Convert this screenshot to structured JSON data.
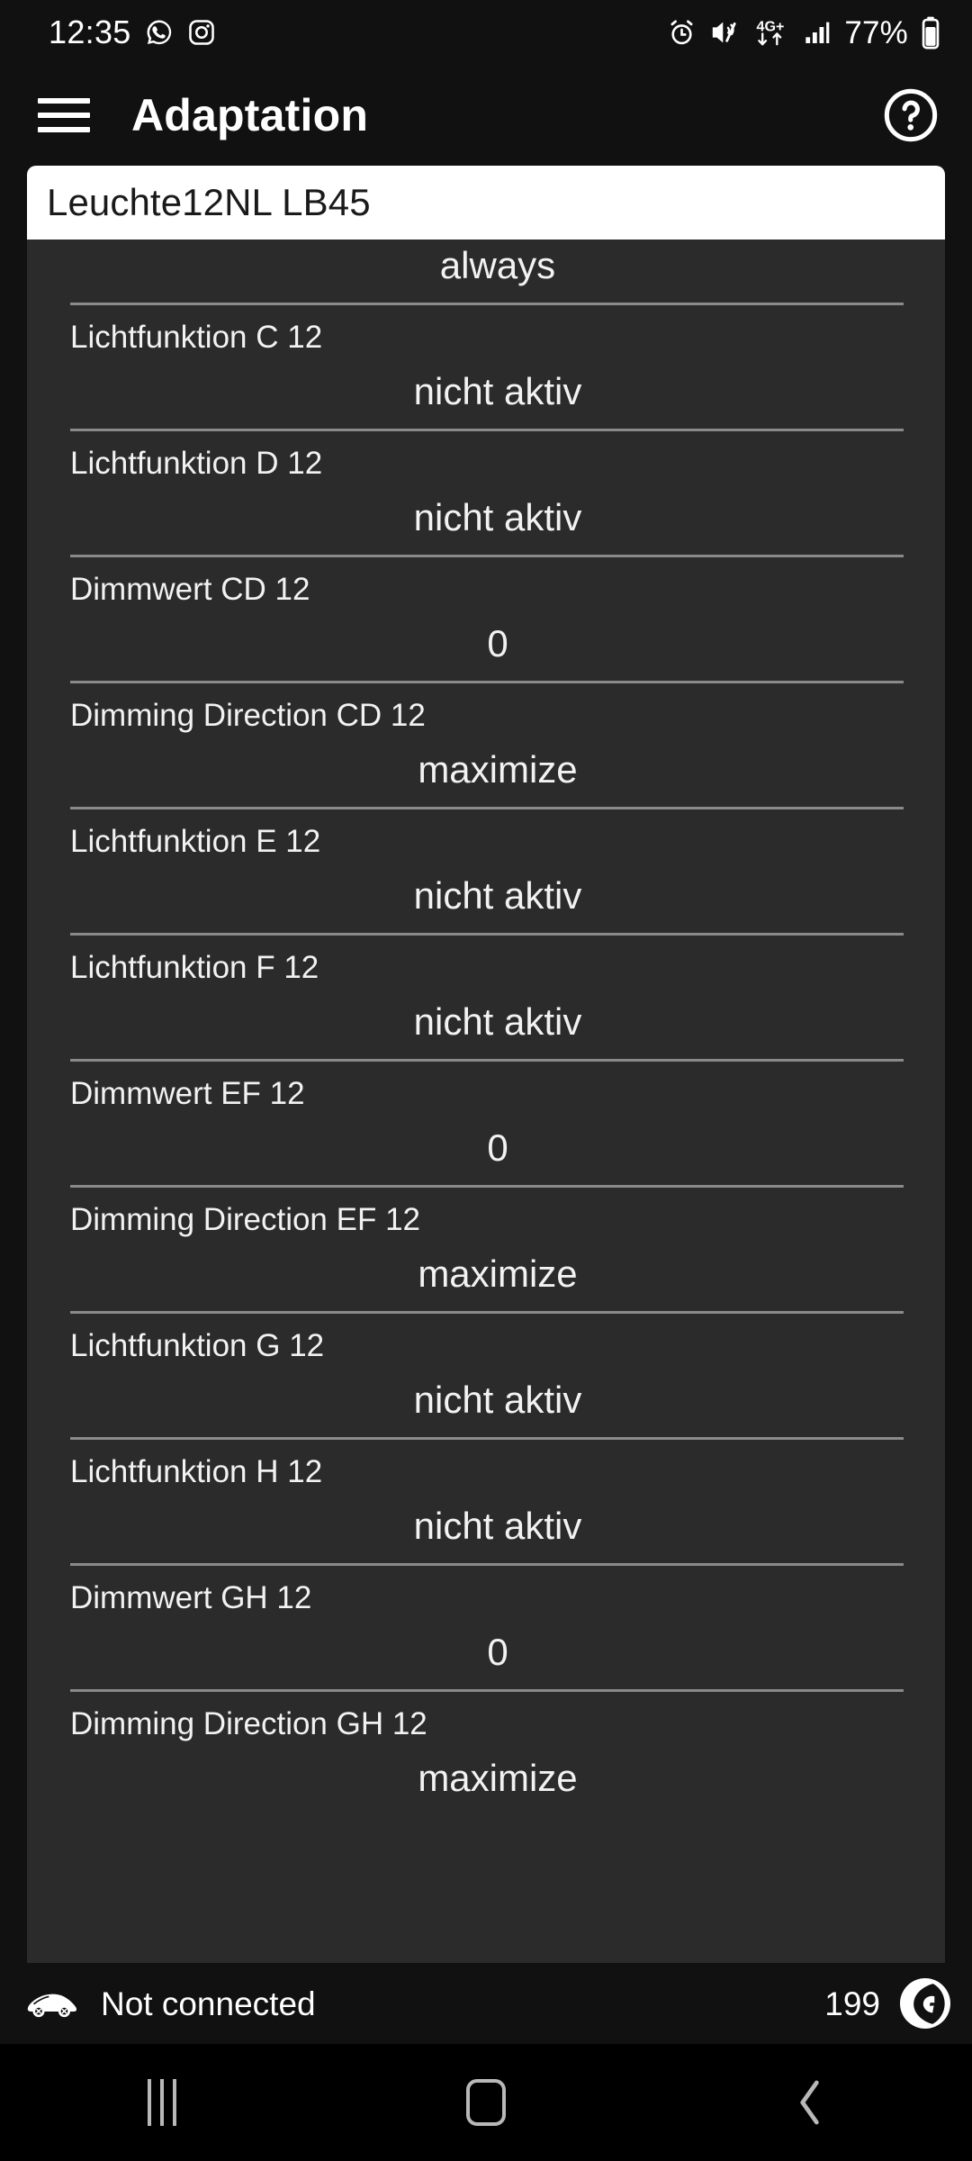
{
  "status_bar": {
    "time": "12:35",
    "battery_percent": "77%",
    "network_label": "4G+",
    "left_icons": [
      "whatsapp-icon",
      "instagram-icon"
    ],
    "right_icons": [
      "alarm-icon",
      "mute-vibrate-icon",
      "mobile-data-icon",
      "signal-bars-icon",
      "battery-icon"
    ]
  },
  "app_bar": {
    "menu_icon": "hamburger-menu-icon",
    "title": "Adaptation",
    "help_icon": "help-circle-icon"
  },
  "title_field": {
    "value": "Leuchte12NL LB45"
  },
  "list": {
    "rows": [
      {
        "label": "",
        "value": "always",
        "clipped": true
      },
      {
        "label": "Lichtfunktion C 12",
        "value": "nicht aktiv",
        "clipped": false
      },
      {
        "label": "Lichtfunktion D 12",
        "value": "nicht aktiv",
        "clipped": false
      },
      {
        "label": "Dimmwert CD 12",
        "value": "0",
        "clipped": false
      },
      {
        "label": "Dimming Direction CD 12",
        "value": "maximize",
        "clipped": false
      },
      {
        "label": "Lichtfunktion E 12",
        "value": "nicht aktiv",
        "clipped": false
      },
      {
        "label": "Lichtfunktion F 12",
        "value": "nicht aktiv",
        "clipped": false
      },
      {
        "label": "Dimmwert EF 12",
        "value": "0",
        "clipped": false
      },
      {
        "label": "Dimming Direction EF 12",
        "value": "maximize",
        "clipped": false
      },
      {
        "label": "Lichtfunktion G 12",
        "value": "nicht aktiv",
        "clipped": false
      },
      {
        "label": "Lichtfunktion H 12",
        "value": "nicht aktiv",
        "clipped": false
      },
      {
        "label": "Dimmwert GH 12",
        "value": "0",
        "clipped": false
      },
      {
        "label": "Dimming Direction GH 12",
        "value": "maximize",
        "clipped": false
      }
    ]
  },
  "bottom_bar": {
    "connection_icon": "car-icon",
    "connection_status": "Not connected",
    "counter": "199",
    "logo_icon": "app-logo-icon"
  },
  "nav_bar": {
    "recents_icon": "recents-icon",
    "home_icon": "home-icon",
    "back_icon": "back-icon"
  },
  "colors": {
    "background": "#111111",
    "panel": "#2b2b2b",
    "title_field_bg": "#ffffff",
    "divider": "#8a8a8a",
    "text": "#f2f2f2",
    "nav_icon": "#b8b8b8"
  }
}
